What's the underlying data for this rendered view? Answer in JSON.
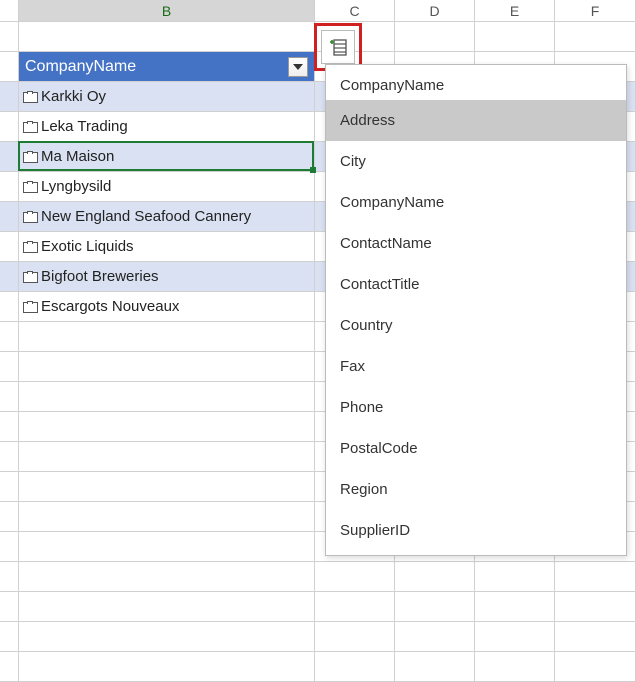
{
  "columns": {
    "B": "B",
    "C": "C",
    "D": "D",
    "E": "E",
    "F": "F"
  },
  "active_column": "B",
  "table_header": "CompanyName",
  "records": [
    "Karkki Oy",
    "Leka Trading",
    "Ma Maison",
    "Lyngbysild",
    "New England Seafood Cannery",
    "Exotic Liquids",
    "Bigfoot Breweries",
    "Escargots Nouveaux"
  ],
  "selected_record_index": 2,
  "popup": {
    "title": "CompanyName",
    "items": [
      "Address",
      "City",
      "CompanyName",
      "ContactName",
      "ContactTitle",
      "Country",
      "Fax",
      "Phone",
      "PostalCode",
      "Region",
      "SupplierID"
    ],
    "selected_item_index": 0
  }
}
